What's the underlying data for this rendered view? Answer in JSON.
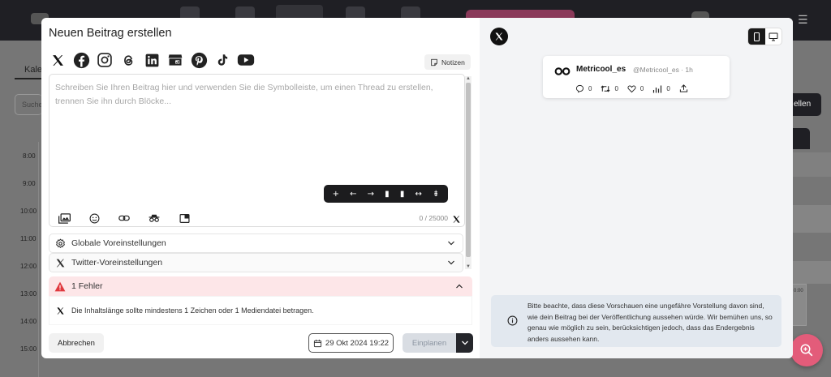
{
  "background": {
    "tab_label": "Kale",
    "search_placeholder": "Suche",
    "right_button_label": "ellen",
    "hours": [
      "8:00",
      "9:00",
      "10:00",
      "11:00",
      "12:00",
      "13:00",
      "14:00",
      "15:00"
    ],
    "event_time": "0:00"
  },
  "dialog": {
    "title": "Neuen Beitrag erstellen",
    "networks": [
      "x-icon",
      "facebook-icon",
      "instagram-icon",
      "threads-icon",
      "linkedin-icon",
      "google-business-icon",
      "pinterest-icon",
      "tiktok-icon",
      "youtube-icon"
    ],
    "notes_label": "Notizen",
    "editor": {
      "placeholder": "Schreiben Sie Ihren Beitrag hier und verwenden Sie die Symbolleiste, um einen Thread zu erstellen, trennen Sie ihn durch Blöcke...",
      "toolbar": [
        "+",
        "←",
        "→",
        "▮",
        "▮",
        "↔",
        "⇟"
      ],
      "bottom_tools": [
        "media-icon",
        "emoji-icon",
        "link-icon",
        "incognito-icon",
        "folder-icon"
      ],
      "char_count": "0 / 25000"
    },
    "accordions": {
      "global": "Globale Voreinstellungen",
      "twitter": "Twitter-Voreinstellungen"
    },
    "errors": {
      "header": "1 Fehler",
      "message": "Die Inhaltslänge sollte mindestens 1 Zeichen oder 1 Mediendatei betragen."
    },
    "footer": {
      "cancel_label": "Abbrechen",
      "date_label": "29 Okt 2024 19:22",
      "schedule_label": "Einplanen"
    }
  },
  "preview": {
    "network": "x-icon",
    "device_modes": [
      "mobile-icon",
      "desktop-icon"
    ],
    "active_device": "mobile-icon",
    "tweet": {
      "name": "Metricool_es",
      "handle": "@Metricool_es · 1h",
      "replies": "0",
      "retweets": "0",
      "likes": "0",
      "views": "0"
    },
    "info_text": "Bitte beachte, dass diese Vorschauen eine ungefähre Vorstellung davon sind, wie dein Beitrag bei der Veröffentlichung aussehen würde. Wir bemühen uns, so genau wie möglich zu sein, berücksichtigen jedoch, dass das Endergebnis anders aussehen kann."
  },
  "colors": {
    "error_bg": "#fde6e8",
    "error_icon": "#e0383e",
    "dark": "#1c1c1e",
    "fab": "#e35c7a"
  }
}
